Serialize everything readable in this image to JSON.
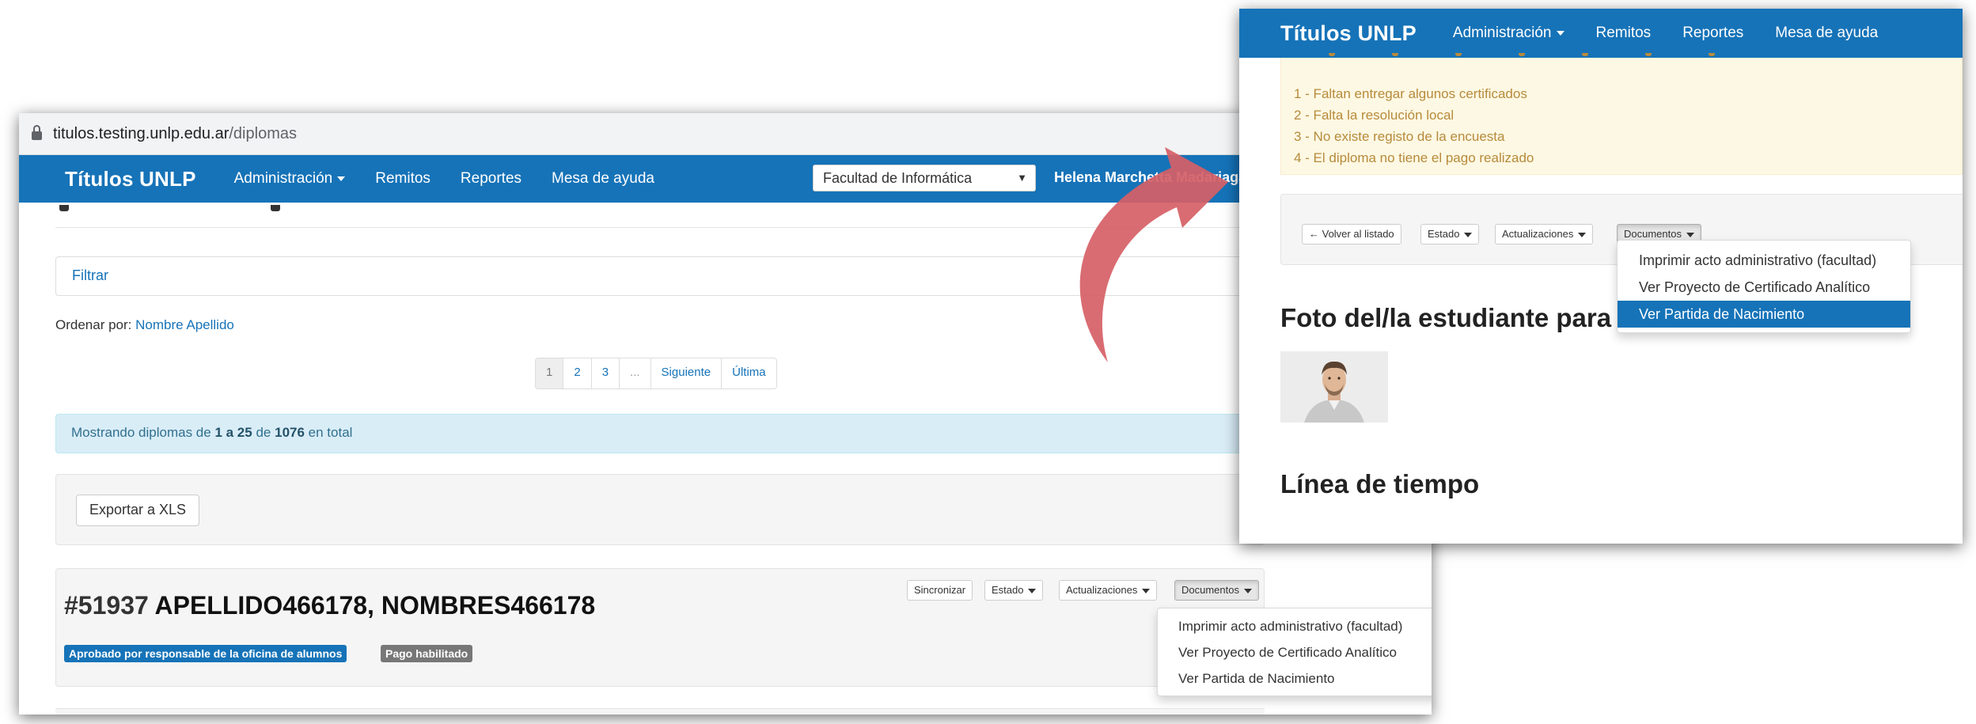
{
  "left_window": {
    "url_host": "titulos.testing.unlp.edu.ar",
    "url_path": "/diplomas",
    "navbar": {
      "brand": "Títulos UNLP",
      "items": [
        "Administración",
        "Remitos",
        "Reportes",
        "Mesa de ayuda"
      ],
      "faculty_select": "Facultad de Informática",
      "user": "Helena Marchetta Madariaga"
    },
    "filter_label": "Filtrar",
    "order_by_label": "Ordenar por:",
    "order_by_value": "Nombre Apellido",
    "pagination": [
      "1",
      "2",
      "3",
      "...",
      "Siguiente",
      "Última"
    ],
    "info": {
      "prefix": "Mostrando diplomas de",
      "range": "1 a 25",
      "of": "de",
      "total": "1076",
      "suffix": "en total"
    },
    "export_button": "Exportar a XLS",
    "record": {
      "id": "#51937",
      "name": "APELLIDO466178, NOMBRES466178",
      "badges": [
        "Aprobado por responsable de la oficina de alumnos",
        "Pago habilitado"
      ],
      "buttons": {
        "sync": "Sincronizar",
        "estado": "Estado",
        "actualizaciones": "Actualizaciones",
        "documentos": "Documentos"
      },
      "documentos_menu": [
        "Imprimir acto administrativo (facultad)",
        "Ver Proyecto de Certificado Analítico",
        "Ver Partida de Nacimiento"
      ]
    }
  },
  "right_window": {
    "navbar": {
      "brand": "Títulos UNLP",
      "items": [
        "Administración",
        "Remitos",
        "Reportes",
        "Mesa de ayuda"
      ]
    },
    "warnings": [
      "1 - Faltan entregar algunos certificados",
      "2 - Falta la resolución local",
      "3 - No existe registo de la encuesta",
      "4 - El diploma no tiene el pago realizado"
    ],
    "buttons": {
      "back": "← Volver al listado",
      "estado": "Estado",
      "actualizaciones": "Actualizaciones",
      "documentos": "Documentos"
    },
    "documentos_menu": [
      "Imprimir acto administrativo (facultad)",
      "Ver Proyecto de Certificado Analítico",
      "Ver Partida de Nacimiento"
    ],
    "highlighted_menu_item": "Ver Partida de Nacimiento",
    "photo_heading": "Foto del/la estudiante para",
    "timeline_heading": "Línea de tiempo"
  },
  "colors": {
    "navbar": "#1673b8",
    "arrow": "#d65f66",
    "warning_text": "#b88a3b",
    "info_text": "#31708f"
  }
}
